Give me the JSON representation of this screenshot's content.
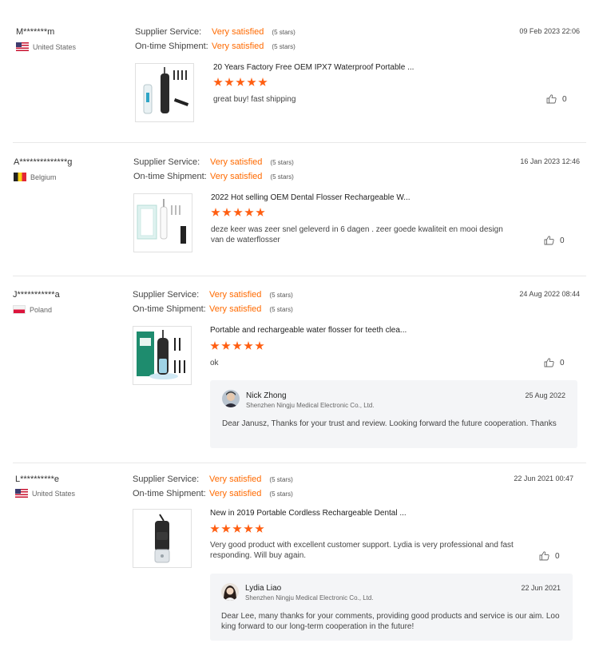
{
  "reviews": [
    {
      "buyer": "M*******m",
      "country": "United States",
      "flag": "us",
      "supplier_service_label": "Supplier Service:",
      "supplier_service_value": "Very satisfied",
      "supplier_service_stars": "(5 stars)",
      "shipment_label": "On-time Shipment:",
      "shipment_value": "Very satisfied",
      "shipment_stars": "(5 stars)",
      "date": "09 Feb 2023 22:06",
      "product": "20 Years Factory Free OEM IPX7 Waterproof Portable ...",
      "rating": 5,
      "comment": "great buy! fast shipping",
      "likes": "0"
    },
    {
      "buyer": "A**************g",
      "country": "Belgium",
      "flag": "be",
      "supplier_service_label": "Supplier Service:",
      "supplier_service_value": "Very satisfied",
      "supplier_service_stars": "(5 stars)",
      "shipment_label": "On-time Shipment:",
      "shipment_value": "Very satisfied",
      "shipment_stars": "(5 stars)",
      "date": "16 Jan 2023 12:46",
      "product": "2022 Hot selling OEM Dental Flosser Rechargeable W...",
      "rating": 5,
      "comment": "deze keer was zeer snel geleverd in 6 dagen . zeer goede kwaliteit en mooi design van de waterflosser",
      "likes": "0"
    },
    {
      "buyer": "J***********a",
      "country": "Poland",
      "flag": "pl",
      "supplier_service_label": "Supplier Service:",
      "supplier_service_value": "Very satisfied",
      "supplier_service_stars": "(5 stars)",
      "shipment_label": "On-time Shipment:",
      "shipment_value": "Very satisfied",
      "shipment_stars": "(5 stars)",
      "date": "24 Aug 2022 08:44",
      "product": "Portable and rechargeable water flosser for teeth clea...",
      "rating": 5,
      "comment": "ok",
      "likes": "0",
      "reply": {
        "name": "Nick Zhong",
        "company": "Shenzhen Ningju Medical Electronic Co., Ltd.",
        "date": "25 Aug 2022",
        "text": "Dear Janusz, Thanks for your trust and review. Looking forward the future cooperation. Thanks"
      }
    },
    {
      "buyer": "L**********e",
      "country": "United States",
      "flag": "us",
      "supplier_service_label": "Supplier Service:",
      "supplier_service_value": "Very satisfied",
      "supplier_service_stars": "(5 stars)",
      "shipment_label": "On-time Shipment:",
      "shipment_value": "Very satisfied",
      "shipment_stars": "(5 stars)",
      "date": "22 Jun 2021 00:47",
      "product": "New in 2019 Portable Cordless Rechargeable Dental ...",
      "rating": 5,
      "comment": "Very good product with excellent customer support. Lydia is very professional and fast responding. Will buy again.",
      "likes": "0",
      "reply": {
        "name": "Lydia Liao",
        "company": "Shenzhen Ningju Medical Electronic Co., Ltd.",
        "date": "22 Jun 2021",
        "text": "Dear Lee, many thanks for your comments, providing good products and service is our aim. Looking forward to our long-term cooperation in the future!"
      }
    }
  ]
}
